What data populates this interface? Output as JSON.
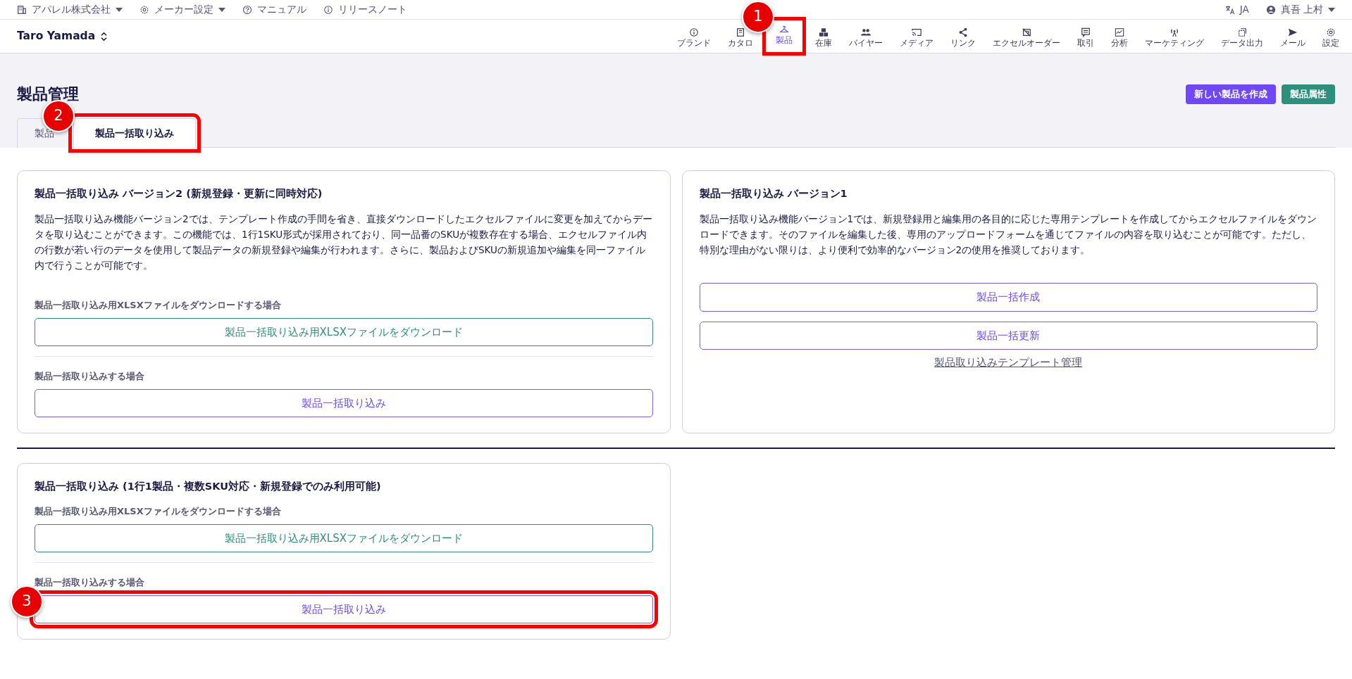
{
  "top_bar": {
    "left": [
      {
        "kind": "building",
        "label": "アパレル株式会社",
        "dropdown": true
      },
      {
        "kind": "gear",
        "label": "メーカー設定",
        "dropdown": true
      },
      {
        "kind": "help",
        "label": "マニュアル",
        "dropdown": false
      },
      {
        "kind": "info",
        "label": "リリースノート",
        "dropdown": false
      }
    ],
    "right": [
      {
        "kind": "translate",
        "label": "JA",
        "dropdown": false
      },
      {
        "kind": "user",
        "label": "真吾 上村",
        "dropdown": true
      }
    ]
  },
  "header": {
    "account": "Taro Yamada"
  },
  "nav": [
    {
      "kind": "info",
      "label": "ブランド",
      "selected": false
    },
    {
      "kind": "book",
      "label": "カタロ",
      "selected": false
    },
    {
      "kind": "hanger",
      "label": "製品",
      "selected": true,
      "callout": "1"
    },
    {
      "kind": "boxes",
      "label": "在庫",
      "selected": false
    },
    {
      "kind": "people",
      "label": "バイヤー",
      "selected": false
    },
    {
      "kind": "cast",
      "label": "メディア",
      "selected": false
    },
    {
      "kind": "share",
      "label": "リンク",
      "selected": false
    },
    {
      "kind": "sheet",
      "label": "エクセルオーダー",
      "selected": false
    },
    {
      "kind": "chat",
      "label": "取引",
      "selected": false
    },
    {
      "kind": "chart",
      "label": "分析",
      "selected": false
    },
    {
      "kind": "antenna",
      "label": "マーケティング",
      "selected": false
    },
    {
      "kind": "copy",
      "label": "データ出力",
      "selected": false
    },
    {
      "kind": "send",
      "label": "メール",
      "selected": false
    },
    {
      "kind": "gear",
      "label": "設定",
      "selected": false
    }
  ],
  "page": {
    "title": "製品管理",
    "actions": [
      {
        "kind": "primary",
        "label": "新しい製品を作成"
      },
      {
        "kind": "secondary",
        "label": "製品属性"
      }
    ],
    "tabs": [
      {
        "label": "製品",
        "selected": false
      },
      {
        "label": "製品一括取り込み",
        "selected": true,
        "callout": "2"
      }
    ]
  },
  "cards_top": [
    {
      "title": "製品一括取り込み バージョン2 (新規登録・更新に同時対応)",
      "description": "製品一括取り込み機能バージョン2では、テンプレート作成の手間を省き、直接ダウンロードしたエクセルファイルに変更を加えてからデータを取り込むことができます。この機能では、1行1SKU形式が採用されており、同一品番のSKUが複数存在する場合、エクセルファイル内の行数が若い行のデータを使用して製品データの新規登録や編集が行われます。さらに、製品およびSKUの新規追加や編集を同一ファイル内で行うことが可能です。",
      "sections": [
        {
          "label": "製品一括取り込み用XLSXファイルをダウンロードする場合",
          "buttons": [
            {
              "kind": "download",
              "label": "製品一括取り込み用XLSXファイルをダウンロード"
            }
          ]
        },
        {
          "label": "製品一括取り込みする場合",
          "buttons": [
            {
              "kind": "import",
              "label": "製品一括取り込み"
            }
          ]
        }
      ]
    },
    {
      "title": "製品一括取り込み バージョン1",
      "description": "製品一括取り込み機能バージョン1では、新規登録用と編集用の各目的に応じた専用テンプレートを作成してからエクセルファイルをダウンロードできます。そのファイルを編集した後、専用のアップロードフォームを通じてファイルの内容を取り込むことが可能です。ただし、特別な理由がない限りは、より便利で効率的なバージョン2の使用を推奨しております。",
      "sections": [
        {
          "buttons": [
            {
              "kind": "import",
              "label": "製品一括作成"
            },
            {
              "kind": "import",
              "label": "製品一括更新"
            }
          ],
          "link": "製品取り込みテンプレート管理"
        }
      ]
    }
  ],
  "cards_bottom": [
    {
      "title": "製品一括取り込み (1行1製品・複数SKU対応・新規登録でのみ利用可能)",
      "sections": [
        {
          "label": "製品一括取り込み用XLSXファイルをダウンロードする場合",
          "buttons": [
            {
              "kind": "download",
              "label": "製品一括取り込み用XLSXファイルをダウンロード"
            }
          ]
        },
        {
          "label": "製品一括取り込みする場合",
          "buttons": [
            {
              "kind": "import",
              "label": "製品一括取り込み",
              "callout": "3"
            }
          ]
        }
      ]
    }
  ]
}
